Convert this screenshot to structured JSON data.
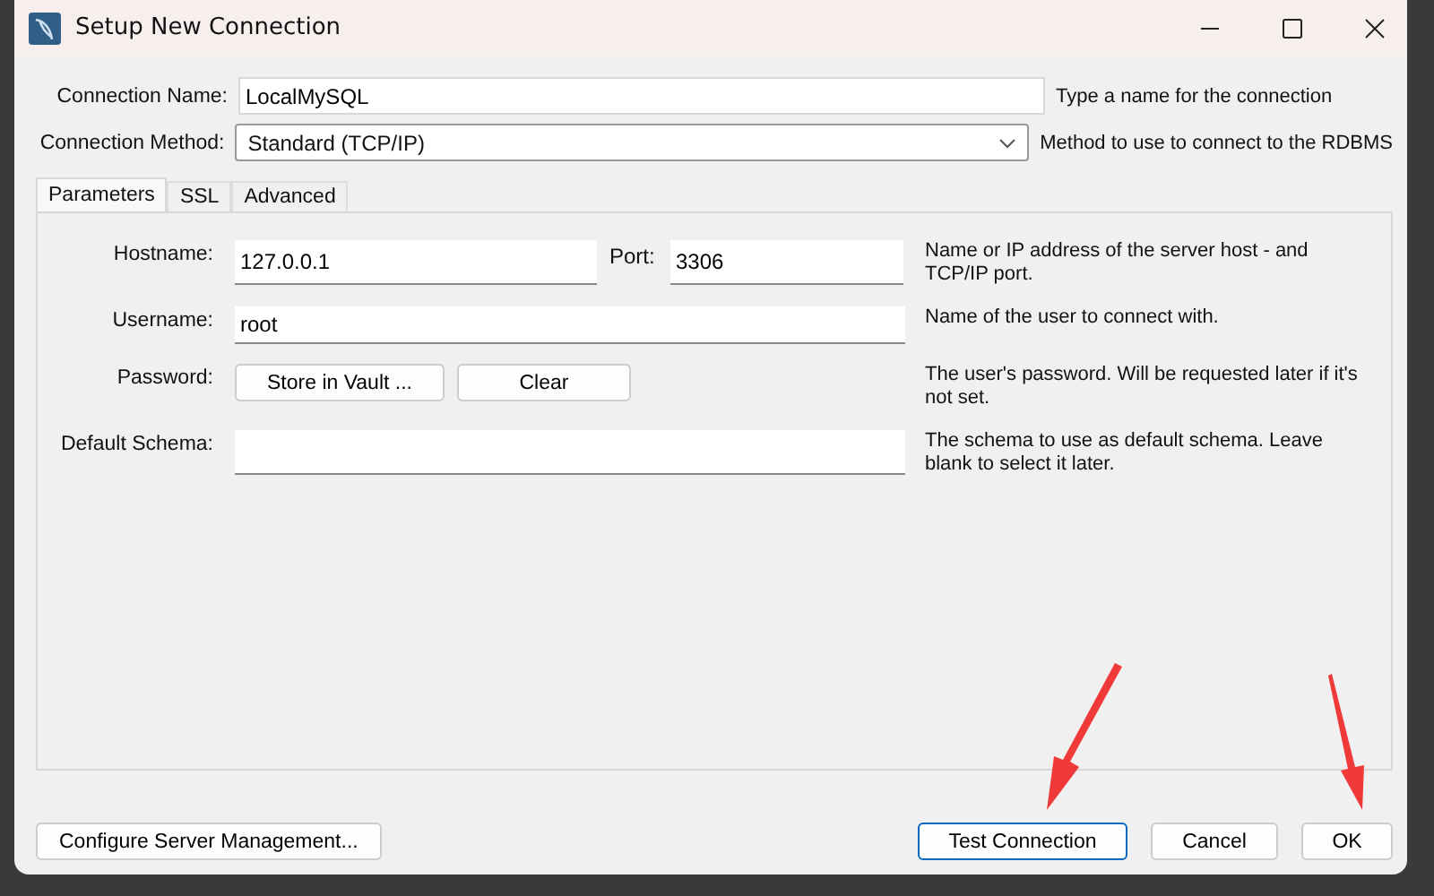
{
  "window": {
    "title": "Setup New Connection"
  },
  "connection_name": {
    "label": "Connection Name:",
    "value": "LocalMySQL",
    "hint": "Type a name for the connection"
  },
  "connection_method": {
    "label": "Connection Method:",
    "value": "Standard (TCP/IP)",
    "hint": "Method to use to connect to the RDBMS"
  },
  "tabs": [
    {
      "label": "Parameters",
      "selected": true
    },
    {
      "label": "SSL",
      "selected": false
    },
    {
      "label": "Advanced",
      "selected": false
    }
  ],
  "parameters": {
    "hostname": {
      "label": "Hostname:",
      "value": "127.0.0.1"
    },
    "port": {
      "label": "Port:",
      "value": "3306"
    },
    "hostname_hint": "Name or IP address of the server host - and TCP/IP port.",
    "username": {
      "label": "Username:",
      "value": "root",
      "hint": "Name of the user to connect with."
    },
    "password": {
      "label": "Password:",
      "buttons": [
        "Store in Vault ...",
        "Clear"
      ],
      "hint": "The user's password. Will be requested later if it's not set."
    },
    "default_schema": {
      "label": "Default Schema:",
      "hint": "The schema to use as default schema. Leave blank to select it later."
    }
  },
  "footer": {
    "left_button": "Configure Server Management...",
    "buttons": [
      {
        "label": "Test Connection",
        "focused": true
      },
      {
        "label": "Cancel",
        "focused": false
      },
      {
        "label": "OK",
        "focused": false
      }
    ]
  }
}
